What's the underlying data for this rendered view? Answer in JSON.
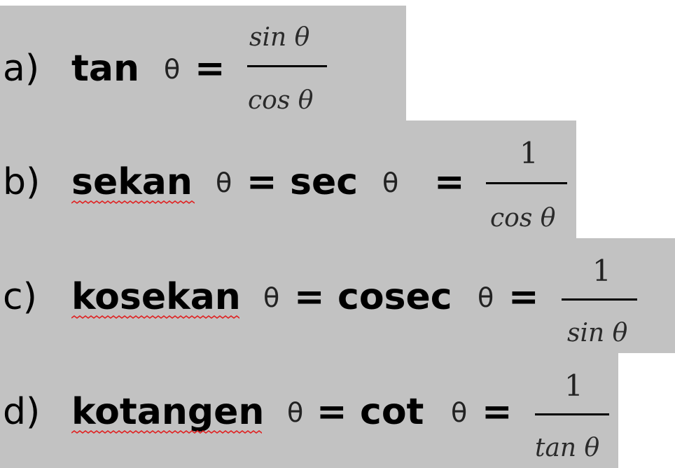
{
  "rows": [
    {
      "label": "a)",
      "term": "tan",
      "theta": "θ",
      "equals": "=",
      "numerator": "sin θ",
      "denominator": "cos θ"
    },
    {
      "label": "b)",
      "term": "sekan",
      "theta": "θ",
      "equals": "=",
      "abbr": "sec",
      "abbr_theta": "θ",
      "equals2": "=",
      "numerator": "1",
      "denominator": "cos θ"
    },
    {
      "label": "c)",
      "term": "kosekan",
      "theta": "θ",
      "equals": "=",
      "abbr": "cosec",
      "abbr_theta": "θ",
      "equals2": "=",
      "numerator": "1",
      "denominator": "sin θ"
    },
    {
      "label": "d)",
      "term": "kotangen",
      "theta": "θ",
      "equals": "=",
      "abbr": "cot",
      "abbr_theta": "θ",
      "equals2": "=",
      "numerator": "1",
      "denominator": "tan θ"
    }
  ],
  "colors": {
    "band": "#c2c2c2",
    "spellcheck": "#e02020",
    "text": "#000000"
  }
}
